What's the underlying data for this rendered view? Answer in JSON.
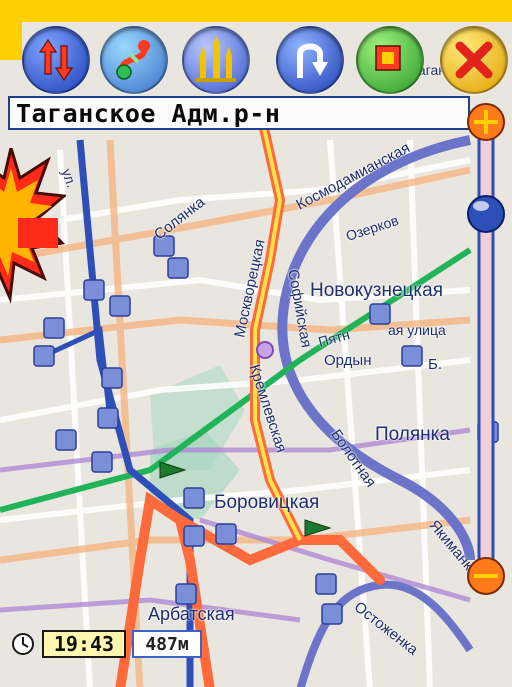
{
  "toolbar": {
    "buttons": [
      {
        "name": "swap-direction-button",
        "icon": "swap-arrows-icon"
      },
      {
        "name": "route-button",
        "icon": "route-icon"
      },
      {
        "name": "landmark-button",
        "icon": "landmark-icon"
      },
      {
        "name": "u-turn-button",
        "icon": "u-turn-icon"
      },
      {
        "name": "layers-button",
        "icon": "layers-icon"
      },
      {
        "name": "close-button",
        "icon": "close-icon"
      }
    ]
  },
  "address_bar": {
    "text": "Таганское Адм.р-н"
  },
  "status": {
    "time": "19:43",
    "distance": "487м"
  },
  "map": {
    "labels": {
      "solyanka": "Солянка",
      "kosmodamianskaya": "Космодамианская",
      "ozerkovskaya": "Озерков",
      "novokuznetskaya": "Новокузнецкая",
      "pyatnitskaya": "Пятн",
      "ordynka": "Ордын",
      "polyanka": "Полянка",
      "borovitskaya": "Боровицкая",
      "arbatskaya": "Арбатская",
      "moskvoretskaya": "Москворецкая",
      "kremlevskaya": "Кремлевская",
      "sofiyskaya": "Софийская",
      "bolotnaya": "Болотная",
      "yakimanka": "Якиманка",
      "ostozhenka": "Остоженка",
      "taganka": "Таганка",
      "ulitsa_top": "ая улица",
      "ul": "ул.",
      "b": "Б."
    },
    "colors": {
      "background": "#e9e6df",
      "route": "#ff6a3d",
      "river": "#6b74c8",
      "metro_green": "#21b35a",
      "metro_blue": "#2f4fb8",
      "metro_purple": "#9a6acb"
    }
  },
  "decor": {
    "badge_color": "#ff2a1a",
    "accent_yellow": "#ffd000"
  }
}
